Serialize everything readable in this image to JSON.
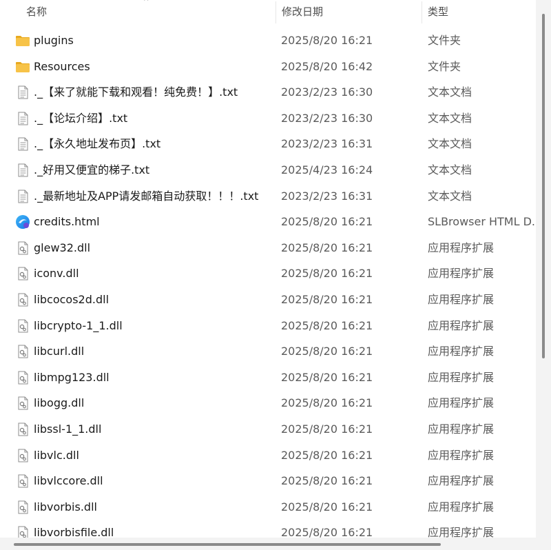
{
  "columns": {
    "name": "名称",
    "date": "修改日期",
    "type": "类型"
  },
  "files": [
    {
      "icon": "folder-icon",
      "name": "plugins",
      "date": "2025/8/20 16:21",
      "type": "文件夹"
    },
    {
      "icon": "folder-icon",
      "name": "Resources",
      "date": "2025/8/20 16:42",
      "type": "文件夹"
    },
    {
      "icon": "text-file-icon",
      "name": "._【来了就能下载和观看！纯免费！】.txt",
      "date": "2023/2/23 16:30",
      "type": "文本文档"
    },
    {
      "icon": "text-file-icon",
      "name": "._【论坛介绍】.txt",
      "date": "2023/2/23 16:30",
      "type": "文本文档"
    },
    {
      "icon": "text-file-icon",
      "name": "._【永久地址发布页】.txt",
      "date": "2023/2/23 16:31",
      "type": "文本文档"
    },
    {
      "icon": "text-file-icon",
      "name": "._好用又便宜的梯子.txt",
      "date": "2025/4/23 16:24",
      "type": "文本文档"
    },
    {
      "icon": "text-file-icon",
      "name": "._最新地址及APP请发邮箱自动获取！！！.txt",
      "date": "2023/2/23 16:31",
      "type": "文本文档"
    },
    {
      "icon": "browser-html-icon",
      "name": "credits.html",
      "date": "2025/8/20 16:21",
      "type": "SLBrowser HTML D..."
    },
    {
      "icon": "dll-file-icon",
      "name": "glew32.dll",
      "date": "2025/8/20 16:21",
      "type": "应用程序扩展"
    },
    {
      "icon": "dll-file-icon",
      "name": "iconv.dll",
      "date": "2025/8/20 16:21",
      "type": "应用程序扩展"
    },
    {
      "icon": "dll-file-icon",
      "name": "libcocos2d.dll",
      "date": "2025/8/20 16:21",
      "type": "应用程序扩展"
    },
    {
      "icon": "dll-file-icon",
      "name": "libcrypto-1_1.dll",
      "date": "2025/8/20 16:21",
      "type": "应用程序扩展"
    },
    {
      "icon": "dll-file-icon",
      "name": "libcurl.dll",
      "date": "2025/8/20 16:21",
      "type": "应用程序扩展"
    },
    {
      "icon": "dll-file-icon",
      "name": "libmpg123.dll",
      "date": "2025/8/20 16:21",
      "type": "应用程序扩展"
    },
    {
      "icon": "dll-file-icon",
      "name": "libogg.dll",
      "date": "2025/8/20 16:21",
      "type": "应用程序扩展"
    },
    {
      "icon": "dll-file-icon",
      "name": "libssl-1_1.dll",
      "date": "2025/8/20 16:21",
      "type": "应用程序扩展"
    },
    {
      "icon": "dll-file-icon",
      "name": "libvlc.dll",
      "date": "2025/8/20 16:21",
      "type": "应用程序扩展"
    },
    {
      "icon": "dll-file-icon",
      "name": "libvlccore.dll",
      "date": "2025/8/20 16:21",
      "type": "应用程序扩展"
    },
    {
      "icon": "dll-file-icon",
      "name": "libvorbis.dll",
      "date": "2025/8/20 16:21",
      "type": "应用程序扩展"
    },
    {
      "icon": "dll-file-icon",
      "name": "libvorbisfile.dll",
      "date": "2025/8/20 16:21",
      "type": "应用程序扩展"
    }
  ],
  "colors": {
    "folder": "#f7c348",
    "folder_tab": "#e8a91f",
    "browser_accent": "#1677e8"
  }
}
